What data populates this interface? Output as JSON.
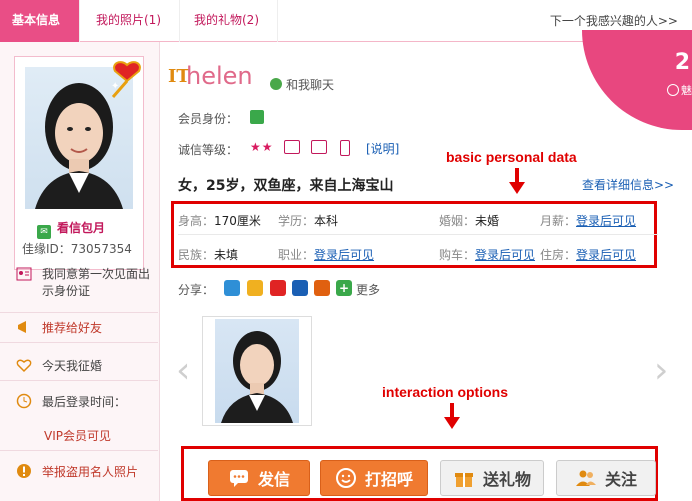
{
  "tabs": [
    {
      "label": "基本信息"
    },
    {
      "label": "我的照片(1)"
    },
    {
      "label": "我的礼物(2)"
    }
  ],
  "next_profile": "下一个我感兴趣的人>>",
  "corner": {
    "number": "2",
    "sub": "魅"
  },
  "sidebar": {
    "baoyue": "看信包月",
    "jiayuan_id": "佳缘ID：73057354",
    "items": [
      {
        "label": "我同意第一次见面出示身份证"
      },
      {
        "label": "推荐给好友"
      },
      {
        "label": "今天我征婚"
      },
      {
        "label": "最后登录时间："
      },
      {
        "label": "VIP会员可见"
      },
      {
        "label": "举报盗用名人照片"
      }
    ]
  },
  "profile": {
    "logo_mark": "IT",
    "name": "helen",
    "chat": "和我聊天",
    "membership_label": "会员身份：",
    "credit_label": "诚信等级：",
    "stars": "★★",
    "explain": "[说明]",
    "summary": "女，25岁，双鱼座，来自上海宝山",
    "detail_link": "查看详细信息>>"
  },
  "annotations": {
    "personal": "basic personal data",
    "interaction": "interaction options"
  },
  "info": {
    "height_label": "身高：",
    "height": "170厘米",
    "edu_label": "学历：",
    "edu": "本科",
    "marriage_label": "婚姻：",
    "marriage": "未婚",
    "salary_label": "月薪：",
    "salary": "登录后可见",
    "nation_label": "民族：",
    "nation": "未填",
    "job_label": "职业：",
    "job": "登录后可见",
    "car_label": "购车：",
    "car": "登录后可见",
    "house_label": "住房：",
    "house": "登录后可见"
  },
  "share": {
    "label": "分享：",
    "more": "更多"
  },
  "actions": {
    "send": "发信",
    "greet": "打招呼",
    "gift": "送礼物",
    "follow": "关注"
  }
}
